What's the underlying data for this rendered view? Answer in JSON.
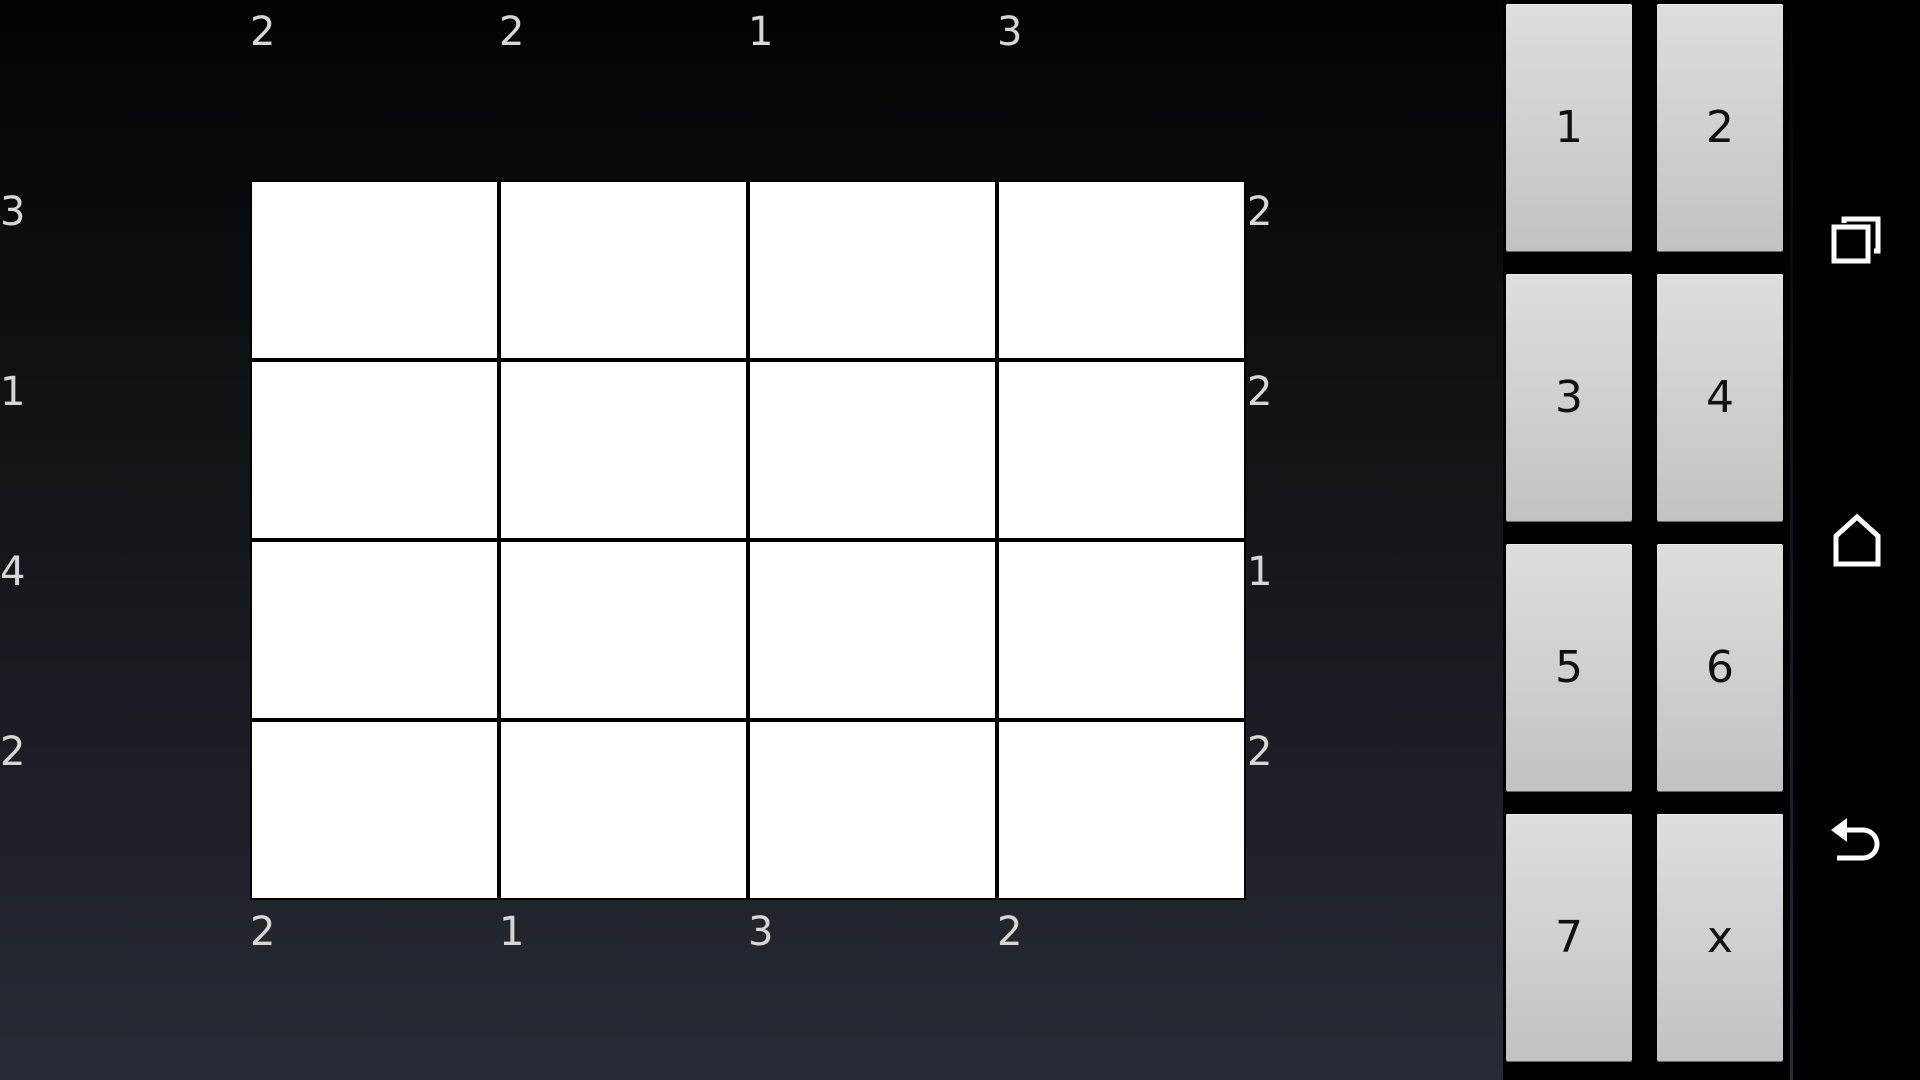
{
  "puzzle": {
    "top_clues": [
      "2",
      "2",
      "1",
      "3"
    ],
    "bottom_clues": [
      "2",
      "1",
      "3",
      "2"
    ],
    "left_clues": [
      "3",
      "1",
      "4",
      "2"
    ],
    "right_clues": [
      "2",
      "2",
      "1",
      "2"
    ],
    "cells": [
      [
        "",
        "",
        "",
        ""
      ],
      [
        "",
        "",
        "",
        ""
      ],
      [
        "",
        "",
        "",
        ""
      ],
      [
        "",
        "",
        "",
        ""
      ]
    ]
  },
  "keypad": {
    "keys": [
      "1",
      "2",
      "3",
      "4",
      "5",
      "6",
      "7",
      "x"
    ]
  },
  "navigation": {
    "icons": [
      "recent-apps-icon",
      "home-icon",
      "back-icon"
    ]
  }
}
